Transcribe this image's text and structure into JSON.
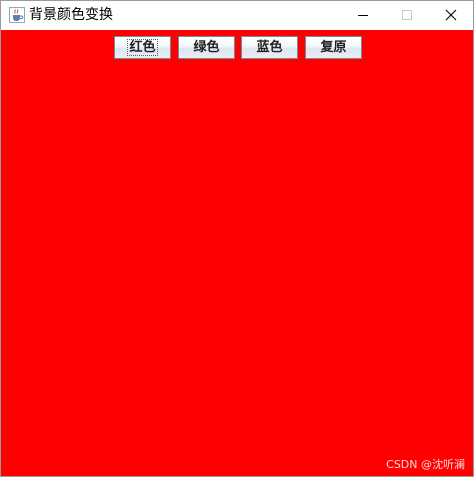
{
  "window": {
    "title": "背景颜色变换",
    "icon": "java-cup-icon",
    "controls": [
      "minimize-icon",
      "maximize-icon",
      "close-icon"
    ]
  },
  "content": {
    "background_color": "#ff0000",
    "buttons": {
      "red": "红色",
      "green": "绿色",
      "blue": "蓝色",
      "reset": "复原"
    },
    "focused_button": "red"
  },
  "watermark": "CSDN @沈听澜"
}
